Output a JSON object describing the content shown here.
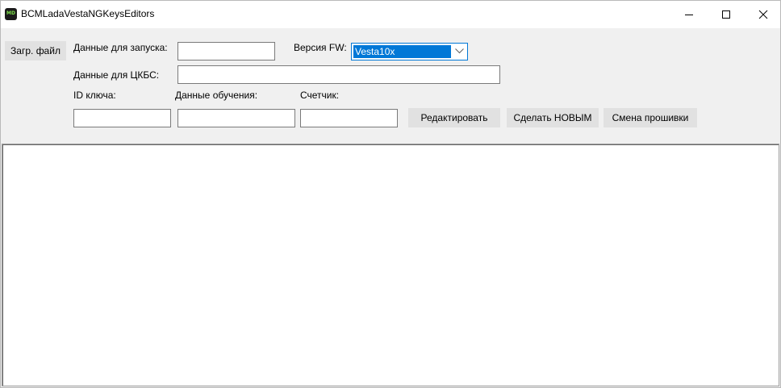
{
  "window": {
    "title": "BCMLadaVestaNGKeysEditors",
    "icon": "app-icon",
    "icon_text": "MD",
    "controls": [
      "minimize-icon",
      "maximize-icon",
      "close-icon"
    ]
  },
  "toolbar": {
    "load_file_label": "Загр. файл",
    "launch_data_label": "Данные для запуска:",
    "launch_data_value": "",
    "fw_version_label": "Версия FW:",
    "fw_version_selected": "Vesta10x",
    "ckbs_data_label": "Данные для ЦКБС:",
    "ckbs_data_value": "",
    "key_id_label": "ID ключа:",
    "key_id_value": "",
    "training_data_label": "Данные обучения:",
    "training_data_value": "",
    "counter_label": "Счетчик:",
    "counter_value": "",
    "edit_label": "Редактировать",
    "make_new_label": "Сделать НОВЫМ",
    "change_firmware_label": "Смена прошивки"
  },
  "output": {
    "text": ""
  },
  "colors": {
    "accent": "#0078d7",
    "window_bg": "#f0f0f0",
    "button_bg": "#e1e1e1",
    "field_border": "#7a7a7a"
  }
}
